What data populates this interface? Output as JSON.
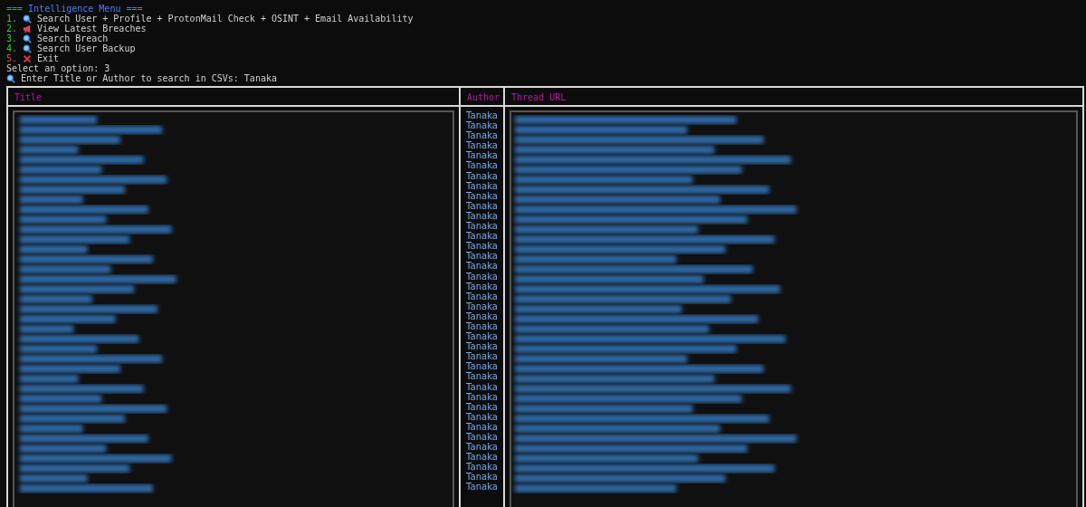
{
  "menu_title": "=== Intelligence Menu ===",
  "menu_items": [
    {
      "number": "1.",
      "kind": "search",
      "label": "Search User + Profile + ProtonMail Check + OSINT + Email Availability"
    },
    {
      "number": "2.",
      "kind": "news",
      "label": "View Latest Breaches"
    },
    {
      "number": "3.",
      "kind": "search",
      "label": "Search Breach"
    },
    {
      "number": "4.",
      "kind": "search",
      "label": "Search User Backup"
    },
    {
      "number": "5.",
      "kind": "exit",
      "label": "Exit"
    }
  ],
  "prompt": "Select an option: 3",
  "search_prompt": "Enter Title or Author to search in CSVs: Tanaka",
  "table": {
    "columns": [
      "Title",
      "Author",
      "Thread URL"
    ],
    "authors": [
      "Tanaka",
      "Tanaka",
      "Tanaka",
      "Tanaka",
      "Tanaka",
      "Tanaka",
      "Tanaka",
      "Tanaka",
      "Tanaka",
      "Tanaka",
      "Tanaka",
      "Tanaka",
      "Tanaka",
      "Tanaka",
      "Tanaka",
      "Tanaka",
      "Tanaka",
      "Tanaka",
      "Tanaka",
      "Tanaka",
      "Tanaka",
      "Tanaka",
      "Tanaka",
      "Tanaka",
      "Tanaka",
      "Tanaka",
      "Tanaka",
      "Tanaka",
      "Tanaka",
      "Tanaka",
      "Tanaka",
      "Tanaka",
      "Tanaka",
      "Tanaka",
      "Tanaka",
      "Tanaka",
      "Tanaka",
      "Tanaka"
    ]
  }
}
